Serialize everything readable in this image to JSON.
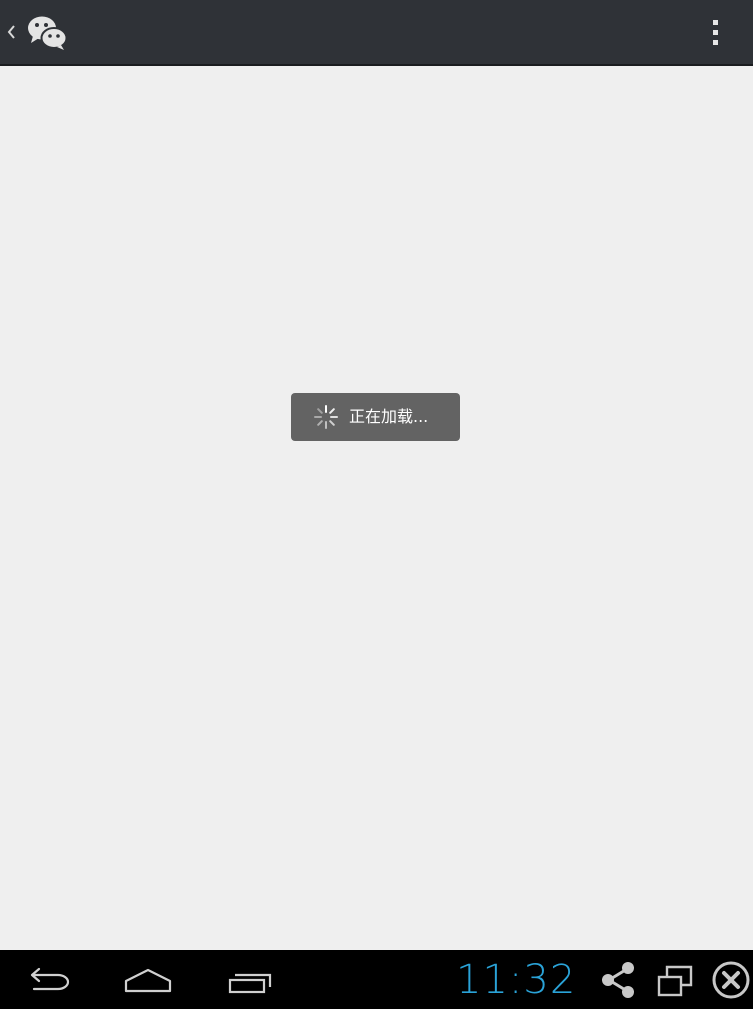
{
  "action_bar": {
    "up_icon": "chevron-left-icon",
    "logo_icon": "wechat-logo-icon",
    "menu_icon": "overflow-menu-icon",
    "background": "#2f3237"
  },
  "content": {
    "loading_text": "正在加载...",
    "spinner_icon": "loading-spinner-icon",
    "background": "#efefef"
  },
  "system_bar": {
    "back_icon": "back-icon",
    "home_icon": "home-icon",
    "recents_icon": "recent-apps-icon",
    "time": "11:32",
    "share_icon": "share-icon",
    "window_icon": "windows-icon",
    "close_icon": "close-circle-icon",
    "clock_color": "#2aa3d8"
  }
}
